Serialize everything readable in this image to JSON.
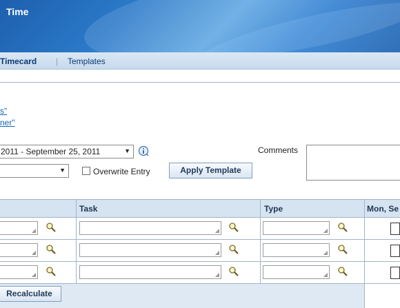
{
  "banner": {
    "title": "Time"
  },
  "tabs": {
    "active_label": "e Timecard",
    "separator": "|",
    "templates_label": "Templates"
  },
  "links": {
    "line1": "s\"",
    "line2": "ner\""
  },
  "period": {
    "value": "2011 - September 25, 2011",
    "info_icon": "info-icon"
  },
  "template_select": {
    "value": ""
  },
  "overwrite": {
    "label": "Overwrite Entry",
    "checked": false
  },
  "apply_button": {
    "label": "Apply Template"
  },
  "comments": {
    "label": "Comments",
    "value": ""
  },
  "table": {
    "columns": [
      "Task",
      "Type",
      "Mon, Se"
    ],
    "rows": [
      {
        "project": "",
        "task": "",
        "type": ""
      },
      {
        "project": "",
        "task": "",
        "type": ""
      },
      {
        "project": "",
        "task": "",
        "type": ""
      }
    ]
  },
  "recalculate_button": {
    "label": "Recalculate"
  },
  "colors": {
    "banner": "#2b79c8",
    "tabbar": "#c7d9ec",
    "header": "#d6e3f0",
    "link": "#1366b0"
  },
  "icons": {
    "search": "magnifier-icon",
    "dropdown": "chevron-down-icon"
  }
}
